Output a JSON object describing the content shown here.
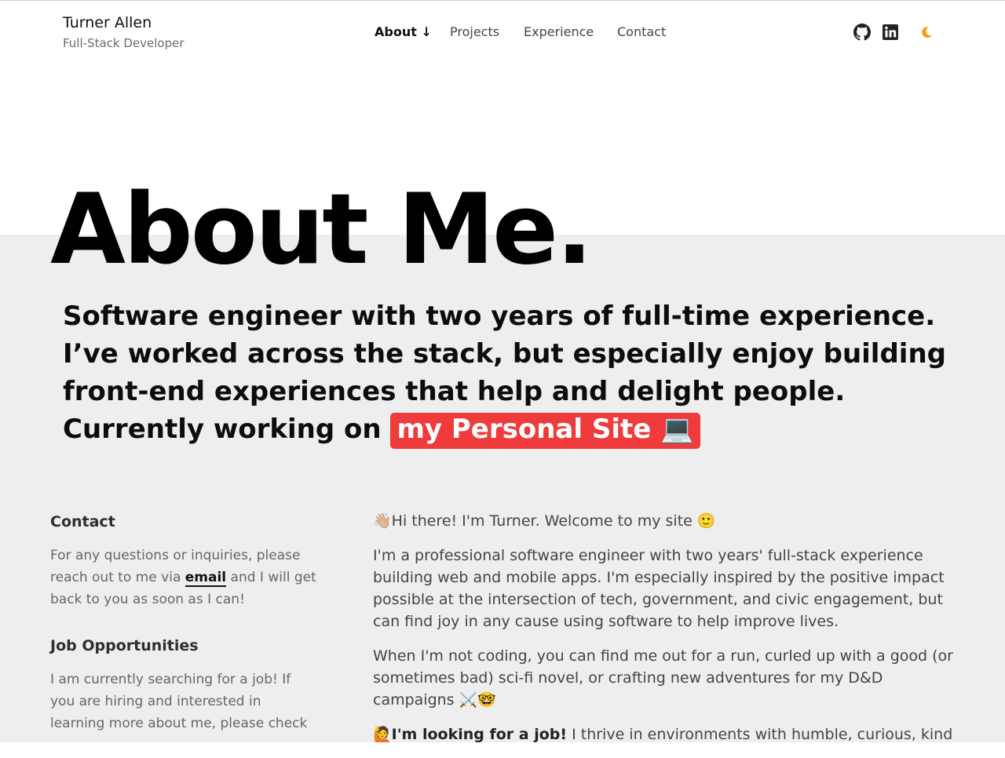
{
  "brand": {
    "name": "Turner Allen",
    "role": "Full-Stack Developer"
  },
  "nav": {
    "items": [
      {
        "label": "About ↓"
      },
      {
        "label": "Projects"
      },
      {
        "label": "Experience"
      },
      {
        "label": "Contact"
      }
    ]
  },
  "header_icons": [
    "github-icon",
    "linkedin-icon",
    "moon-icon"
  ],
  "hero": {
    "title": "About Me."
  },
  "intro": {
    "line1": "Software engineer with two years of full-time experience. I’ve worked across the stack, but especially enjoy building front-end experiences that help and delight people.",
    "current_prefix": "Currently working on",
    "current_project": "my Personal Site 💻"
  },
  "sidebar": {
    "contact_heading": "Contact",
    "contact_text_before": "For any questions or inquiries, please reach out to me via",
    "contact_link": "email",
    "contact_text_after": "and I will get back to you as soon as I can!",
    "jobs_heading": "Job Opportunities",
    "jobs_text": "I am currently searching for a job! If you are hiring and interested in learning more about me, please check"
  },
  "main": {
    "greeting": "👋🏼Hi there! I'm Turner. Welcome to my site 🙂",
    "para1": "I'm a professional software engineer with two years' full-stack experience building web and mobile apps. I'm especially inspired by the positive impact possible at the intersection of tech, government, and civic engagement, but can find joy in any cause using software to help improve lives.",
    "para2": "When I'm not coding, you can find me out for a run, curled up with a good (or sometimes bad) sci-fi novel, or crafting new adventures for my D&D campaigns ⚔️🤓",
    "para3_emoji": "🙋",
    "para3_bold": "I'm looking for a job!",
    "para3_rest": "I thrive in environments with humble, curious, kind"
  },
  "colors": {
    "accent": "#ef3b3b",
    "moon": "#f59e0b",
    "band": "#eeeeee"
  }
}
